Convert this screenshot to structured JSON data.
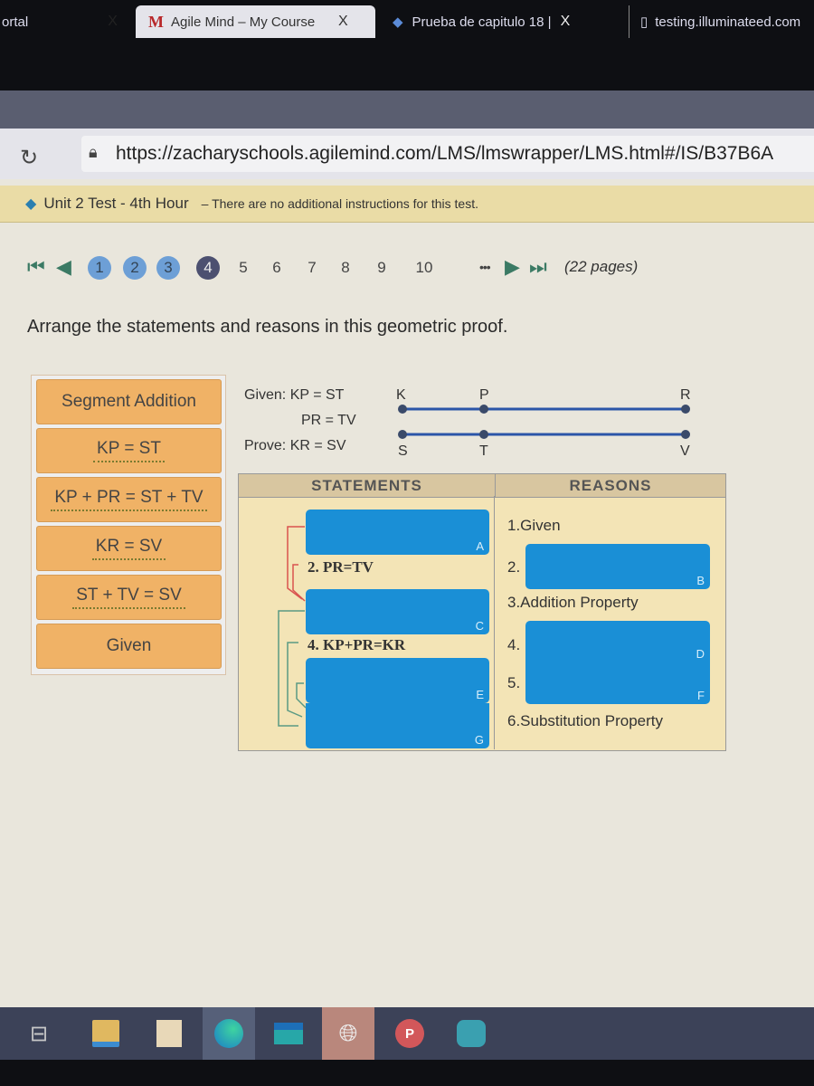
{
  "browser": {
    "tabs": [
      {
        "label": "ortal",
        "close": "X"
      },
      {
        "label": "Agile Mind – My Course",
        "close": "X",
        "active": true
      },
      {
        "label": "Prueba de capitulo 18 |",
        "close": "X"
      },
      {
        "label": "testing.illuminateed.com"
      }
    ],
    "url": "https://zacharyschools.agilemind.com/LMS/lmswrapper/LMS.html#/IS/B37B6A"
  },
  "banner": {
    "title": "Unit 2 Test - 4th Hour",
    "note": "– There are no additional instructions for this test."
  },
  "pager": {
    "pages": [
      "1",
      "2",
      "3",
      "4",
      "5",
      "6",
      "7",
      "8",
      "9",
      "10"
    ],
    "completed": [
      "1",
      "2",
      "3"
    ],
    "current": "4",
    "ellipsis": "•••",
    "total": "(22 pages)"
  },
  "question": {
    "prompt": "Arrange the statements and reasons in this geometric proof."
  },
  "tiles": [
    "Segment Addition",
    "KP = ST",
    "KP + PR = ST + TV",
    "KR = SV",
    "ST + TV = SV",
    "Given"
  ],
  "figure": {
    "given_label": "Given: KP = ST",
    "given2": "PR = TV",
    "prove_label": "Prove: KR = SV",
    "top_points": [
      "K",
      "P",
      "R"
    ],
    "bottom_points": [
      "S",
      "T",
      "V"
    ],
    "line_color": "#2b55a8"
  },
  "proof": {
    "headers": {
      "statements": "STATEMENTS",
      "reasons": "REASONS"
    },
    "statements": [
      {
        "slot": "A"
      },
      {
        "text": "2. PR=TV"
      },
      {
        "slot": "C"
      },
      {
        "text": "4. KP+PR=KR"
      },
      {
        "slot": "E"
      },
      {
        "slot": "G"
      }
    ],
    "reasons": [
      {
        "text": "1.Given"
      },
      {
        "num": "2.",
        "slot": "B"
      },
      {
        "text": "3.Addition Property"
      },
      {
        "num": "4.",
        "slot": "D"
      },
      {
        "num": "5.",
        "slot": "F"
      },
      {
        "text": "6.Substitution Property"
      }
    ]
  },
  "taskbar": {
    "icons": [
      "task-view",
      "file-explorer",
      "store",
      "edge",
      "mail",
      "globe",
      "powerpoint",
      "camera"
    ]
  }
}
